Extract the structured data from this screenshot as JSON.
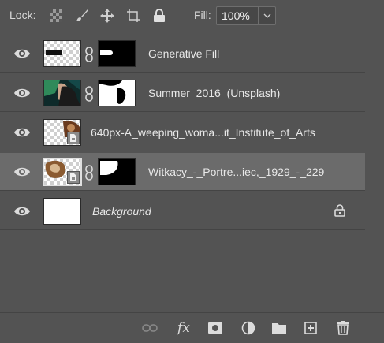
{
  "toolbar": {
    "lock_label": "Lock:",
    "lock_icons": [
      "lock-transparent-pixels-icon",
      "lock-image-pixels-icon",
      "lock-position-icon",
      "lock-artboard-icon",
      "lock-all-icon"
    ],
    "fill_label": "Fill:",
    "fill_value": "100%"
  },
  "layers": [
    {
      "name": "Generative Fill",
      "visible": true,
      "has_mask": true,
      "linked": true,
      "italic": false,
      "selected": false
    },
    {
      "name": "Summer_2016_(Unsplash)",
      "visible": true,
      "has_mask": true,
      "linked": true,
      "italic": false,
      "selected": false
    },
    {
      "name": "640px-A_weeping_woma...it_Institute_of_Arts",
      "visible": true,
      "has_mask": false,
      "linked": false,
      "italic": false,
      "selected": false,
      "smart_object": true
    },
    {
      "name": "Witkacy_-_Portre...iec,_1929_-_229",
      "visible": true,
      "has_mask": true,
      "linked": true,
      "italic": false,
      "selected": true,
      "smart_object": true
    },
    {
      "name": "Background",
      "visible": true,
      "has_mask": false,
      "linked": false,
      "italic": true,
      "selected": false,
      "locked": true
    }
  ],
  "bottombar": {
    "icons": [
      "link-layers-icon",
      "fx-icon",
      "add-mask-icon",
      "adjustment-layer-icon",
      "new-group-icon",
      "new-layer-icon",
      "delete-layer-icon"
    ],
    "fx_label": "fx"
  },
  "colors": {
    "panel": "#535353",
    "selected_row": "#6b6b6b",
    "text": "#e8e8e8"
  }
}
